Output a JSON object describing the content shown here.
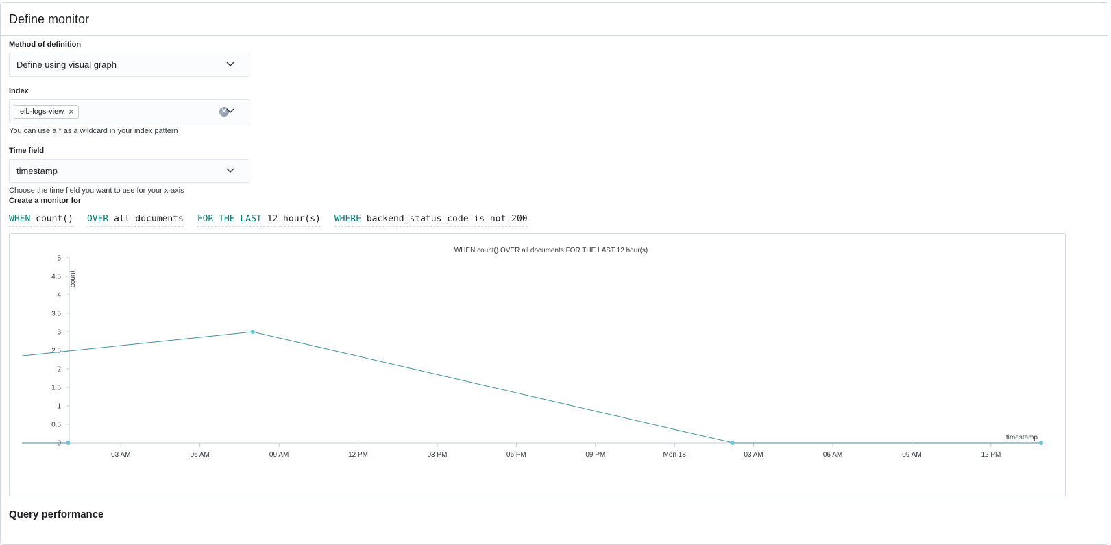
{
  "panel": {
    "title": "Define monitor"
  },
  "method": {
    "label": "Method of definition",
    "value": "Define using visual graph"
  },
  "index": {
    "label": "Index",
    "selected": [
      "elb-logs-view"
    ],
    "help": "You can use a * as a wildcard in your index pattern"
  },
  "time_field": {
    "label": "Time field",
    "value": "timestamp",
    "help": "Choose the time field you want to use for your x-axis"
  },
  "monitor_for": {
    "label": "Create a monitor for",
    "expressions": [
      {
        "keyword": "WHEN",
        "value": "count()"
      },
      {
        "keyword": "OVER",
        "value": "all documents"
      },
      {
        "keyword": "FOR THE LAST",
        "value": "12 hour(s)"
      },
      {
        "keyword": "WHERE",
        "value": "backend_status_code is not 200"
      }
    ]
  },
  "icons": {
    "method_chevron": "chevron-down-icon",
    "index_chevron": "chevron-down-icon",
    "index_clear": "clear-icon",
    "pill_remove": "close-icon",
    "time_chevron": "chevron-down-icon"
  },
  "colors": {
    "keyword": "#017d73",
    "line": "#3f8fa3",
    "point": "#6dc6d6",
    "axis": "#c5cbd4"
  },
  "chart_data": {
    "type": "line",
    "title": "WHEN count() OVER all documents FOR THE LAST 12 hour(s)",
    "xlabel": "timestamp",
    "ylabel": "count",
    "ylim": [
      0,
      5
    ],
    "y_ticks": [
      "0",
      "0.5",
      "1",
      "1.5",
      "2",
      "2.5",
      "3",
      "3.5",
      "4",
      "4.5",
      "5"
    ],
    "x_ticks": [
      "03 AM",
      "06 AM",
      "09 AM",
      "12 PM",
      "03 PM",
      "06 PM",
      "09 PM",
      "Mon 18",
      "03 AM",
      "06 AM",
      "09 AM",
      "12 PM"
    ],
    "x_tick_hours": [
      3,
      6,
      9,
      12,
      15,
      18,
      21,
      24,
      27,
      30,
      33,
      36
    ],
    "xlim_hours": [
      -0.75,
      37.9
    ],
    "series": [
      {
        "points": [
          {
            "hour": -0.75,
            "y": 0
          },
          {
            "hour": 1.0,
            "y": 0
          }
        ]
      },
      {
        "points": [
          {
            "hour": -0.75,
            "y": 2.35
          },
          {
            "hour": 8.0,
            "y": 3
          },
          {
            "hour": 26.2,
            "y": 0
          },
          {
            "hour": 37.9,
            "y": 0
          }
        ]
      }
    ],
    "markers": [
      {
        "hour": 1.0,
        "y": 0
      },
      {
        "hour": 8.0,
        "y": 3
      },
      {
        "hour": 26.2,
        "y": 0
      },
      {
        "hour": 37.9,
        "y": 0
      }
    ]
  },
  "next_section": {
    "title": "Query performance"
  }
}
